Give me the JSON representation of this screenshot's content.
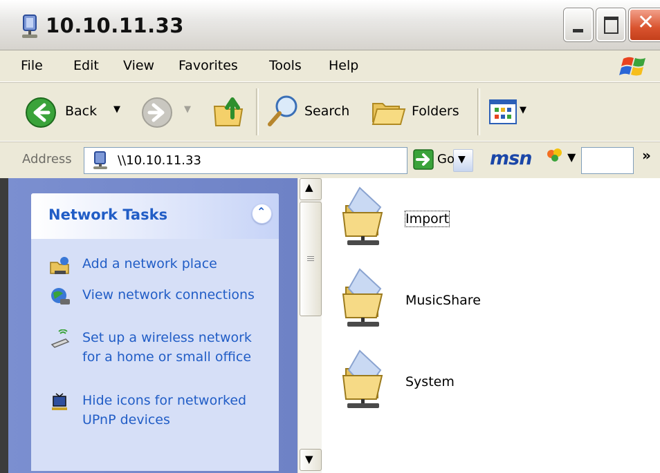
{
  "window": {
    "title": "10.10.11.33"
  },
  "menu": [
    "File",
    "Edit",
    "View",
    "Favorites",
    "Tools",
    "Help"
  ],
  "toolbar": {
    "back_label": "Back",
    "search_label": "Search",
    "folders_label": "Folders"
  },
  "address": {
    "label": "Address",
    "value": "\\\\10.10.11.33",
    "go_label": "Go",
    "msn": "msn"
  },
  "tasks": {
    "title": "Network Tasks",
    "items": [
      {
        "label": "Add a network place",
        "icon": "add-network-place-icon"
      },
      {
        "label": "View network connections",
        "icon": "network-connections-icon"
      },
      {
        "label": "Set up a wireless network for a home or small office",
        "icon": "wireless-network-icon"
      },
      {
        "label": "Hide icons for networked UPnP devices",
        "icon": "upnp-device-icon"
      }
    ]
  },
  "files": [
    {
      "name": "Import"
    },
    {
      "name": "MusicShare"
    },
    {
      "name": "System"
    }
  ],
  "colors": {
    "task_link": "#215dc6",
    "taskpane_bg": "#6e82c6",
    "xp_chrome": "#ece9d8"
  }
}
